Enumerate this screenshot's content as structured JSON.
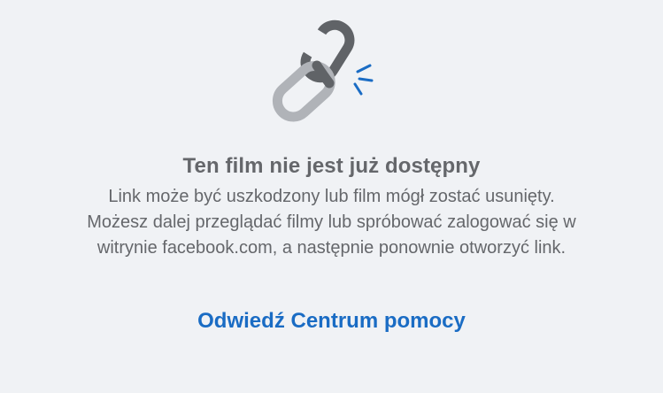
{
  "message": {
    "title": "Ten film nie jest już dostępny",
    "description": "Link może być uszkodzony lub film mógł zostać usunięty. Możesz dalej przeglądać filmy lub spróbować zalogować się w witrynie facebook.com, a następnie ponownie otworzyć link.",
    "help_link": "Odwiedź Centrum pomocy"
  },
  "icon": {
    "name": "broken-link-icon",
    "colors": {
      "chain_dark": "#606367",
      "chain_light": "#b0b3b8",
      "spark": "#1a6cc4"
    }
  },
  "colors": {
    "background": "#f0f2f5",
    "text": "#65676b",
    "link": "#1a6cc4"
  }
}
